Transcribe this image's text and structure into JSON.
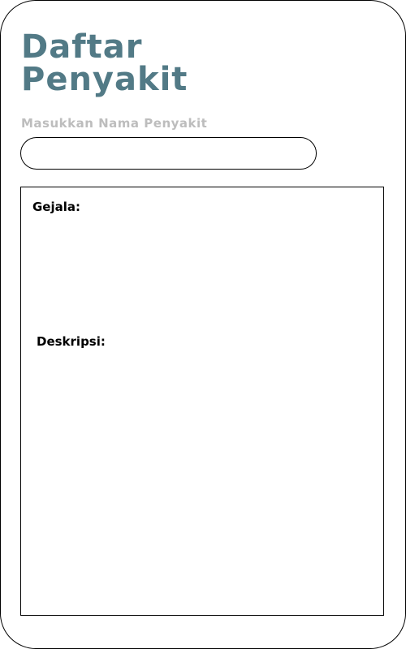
{
  "header": {
    "title_line1": "Daftar",
    "title_line2": "Penyakit"
  },
  "search": {
    "label": "Masukkan Nama Penyakit",
    "value": "",
    "placeholder": ""
  },
  "result": {
    "symptoms_label": "Gejala:",
    "symptoms_value": "",
    "description_label": "Deskripsi:",
    "description_value": ""
  },
  "colors": {
    "title": "#527a86",
    "label": "#bdbdbd"
  }
}
